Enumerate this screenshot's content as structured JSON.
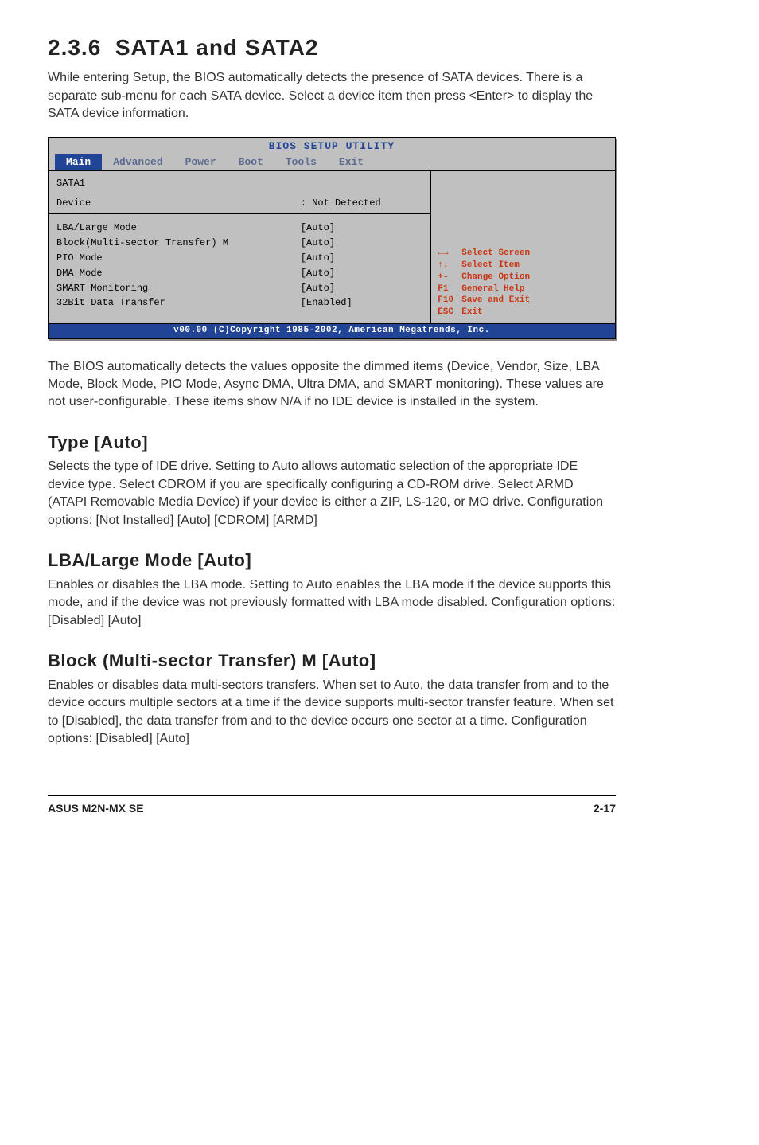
{
  "section": {
    "number": "2.3.6",
    "title": "SATA1 and SATA2",
    "intro": "While entering Setup, the BIOS automatically detects the presence of SATA devices. There is a separate sub-menu for each SATA device. Select a device item then press <Enter> to display the SATA device information."
  },
  "bios": {
    "title": "BIOS SETUP UTILITY",
    "tabs": [
      "Main",
      "Advanced",
      "Power",
      "Boot",
      "Tools",
      "Exit"
    ],
    "active_tab": "Main",
    "header_label": "SATA1",
    "device_label": "Device",
    "device_value": ": Not Detected",
    "rows": [
      {
        "label": "LBA/Large Mode",
        "value": "[Auto]"
      },
      {
        "label": "Block(Multi-sector Transfer) M",
        "value": "[Auto]"
      },
      {
        "label": "PIO Mode",
        "value": "[Auto]"
      },
      {
        "label": "DMA Mode",
        "value": "[Auto]"
      },
      {
        "label": "SMART Monitoring",
        "value": "[Auto]"
      },
      {
        "label": "32Bit Data Transfer",
        "value": "[Enabled]"
      }
    ],
    "help": [
      {
        "key": "←→",
        "text": "Select Screen"
      },
      {
        "key": "↑↓",
        "text": "Select Item"
      },
      {
        "key": "+-",
        "text": "Change Option"
      },
      {
        "key": "F1",
        "text": "General Help"
      },
      {
        "key": "F10",
        "text": "Save and Exit"
      },
      {
        "key": "ESC",
        "text": "Exit"
      }
    ],
    "footer": "v00.00 (C)Copyright 1985-2002, American Megatrends, Inc."
  },
  "after_bios_para": "The BIOS automatically detects the values opposite the dimmed items (Device, Vendor, Size, LBA Mode, Block Mode, PIO Mode, Async DMA, Ultra DMA, and SMART monitoring). These values are not user-configurable. These items show N/A if no IDE device is installed in the system.",
  "options": [
    {
      "title": "Type [Auto]",
      "body": "Selects the type of IDE drive. Setting to Auto allows automatic selection of the appropriate IDE device type. Select CDROM if you are specifically configuring a CD-ROM drive. Select ARMD (ATAPI Removable Media Device) if your device is either a ZIP, LS-120, or MO drive. Configuration options: [Not Installed] [Auto] [CDROM] [ARMD]"
    },
    {
      "title": "LBA/Large Mode [Auto]",
      "body": "Enables or disables the LBA mode. Setting to Auto enables the LBA mode if the device supports this mode, and if the device was not previously formatted with LBA mode disabled. Configuration options: [Disabled] [Auto]"
    },
    {
      "title": "Block (Multi-sector Transfer) M [Auto]",
      "body": "Enables or disables data multi-sectors transfers. When set to Auto, the data transfer from and to the device occurs multiple sectors at a time if the device supports multi-sector transfer feature. When set to [Disabled], the data transfer from and to the device occurs one sector at a time. Configuration options: [Disabled] [Auto]"
    }
  ],
  "footer": {
    "left": "ASUS M2N-MX SE",
    "right": "2-17"
  }
}
